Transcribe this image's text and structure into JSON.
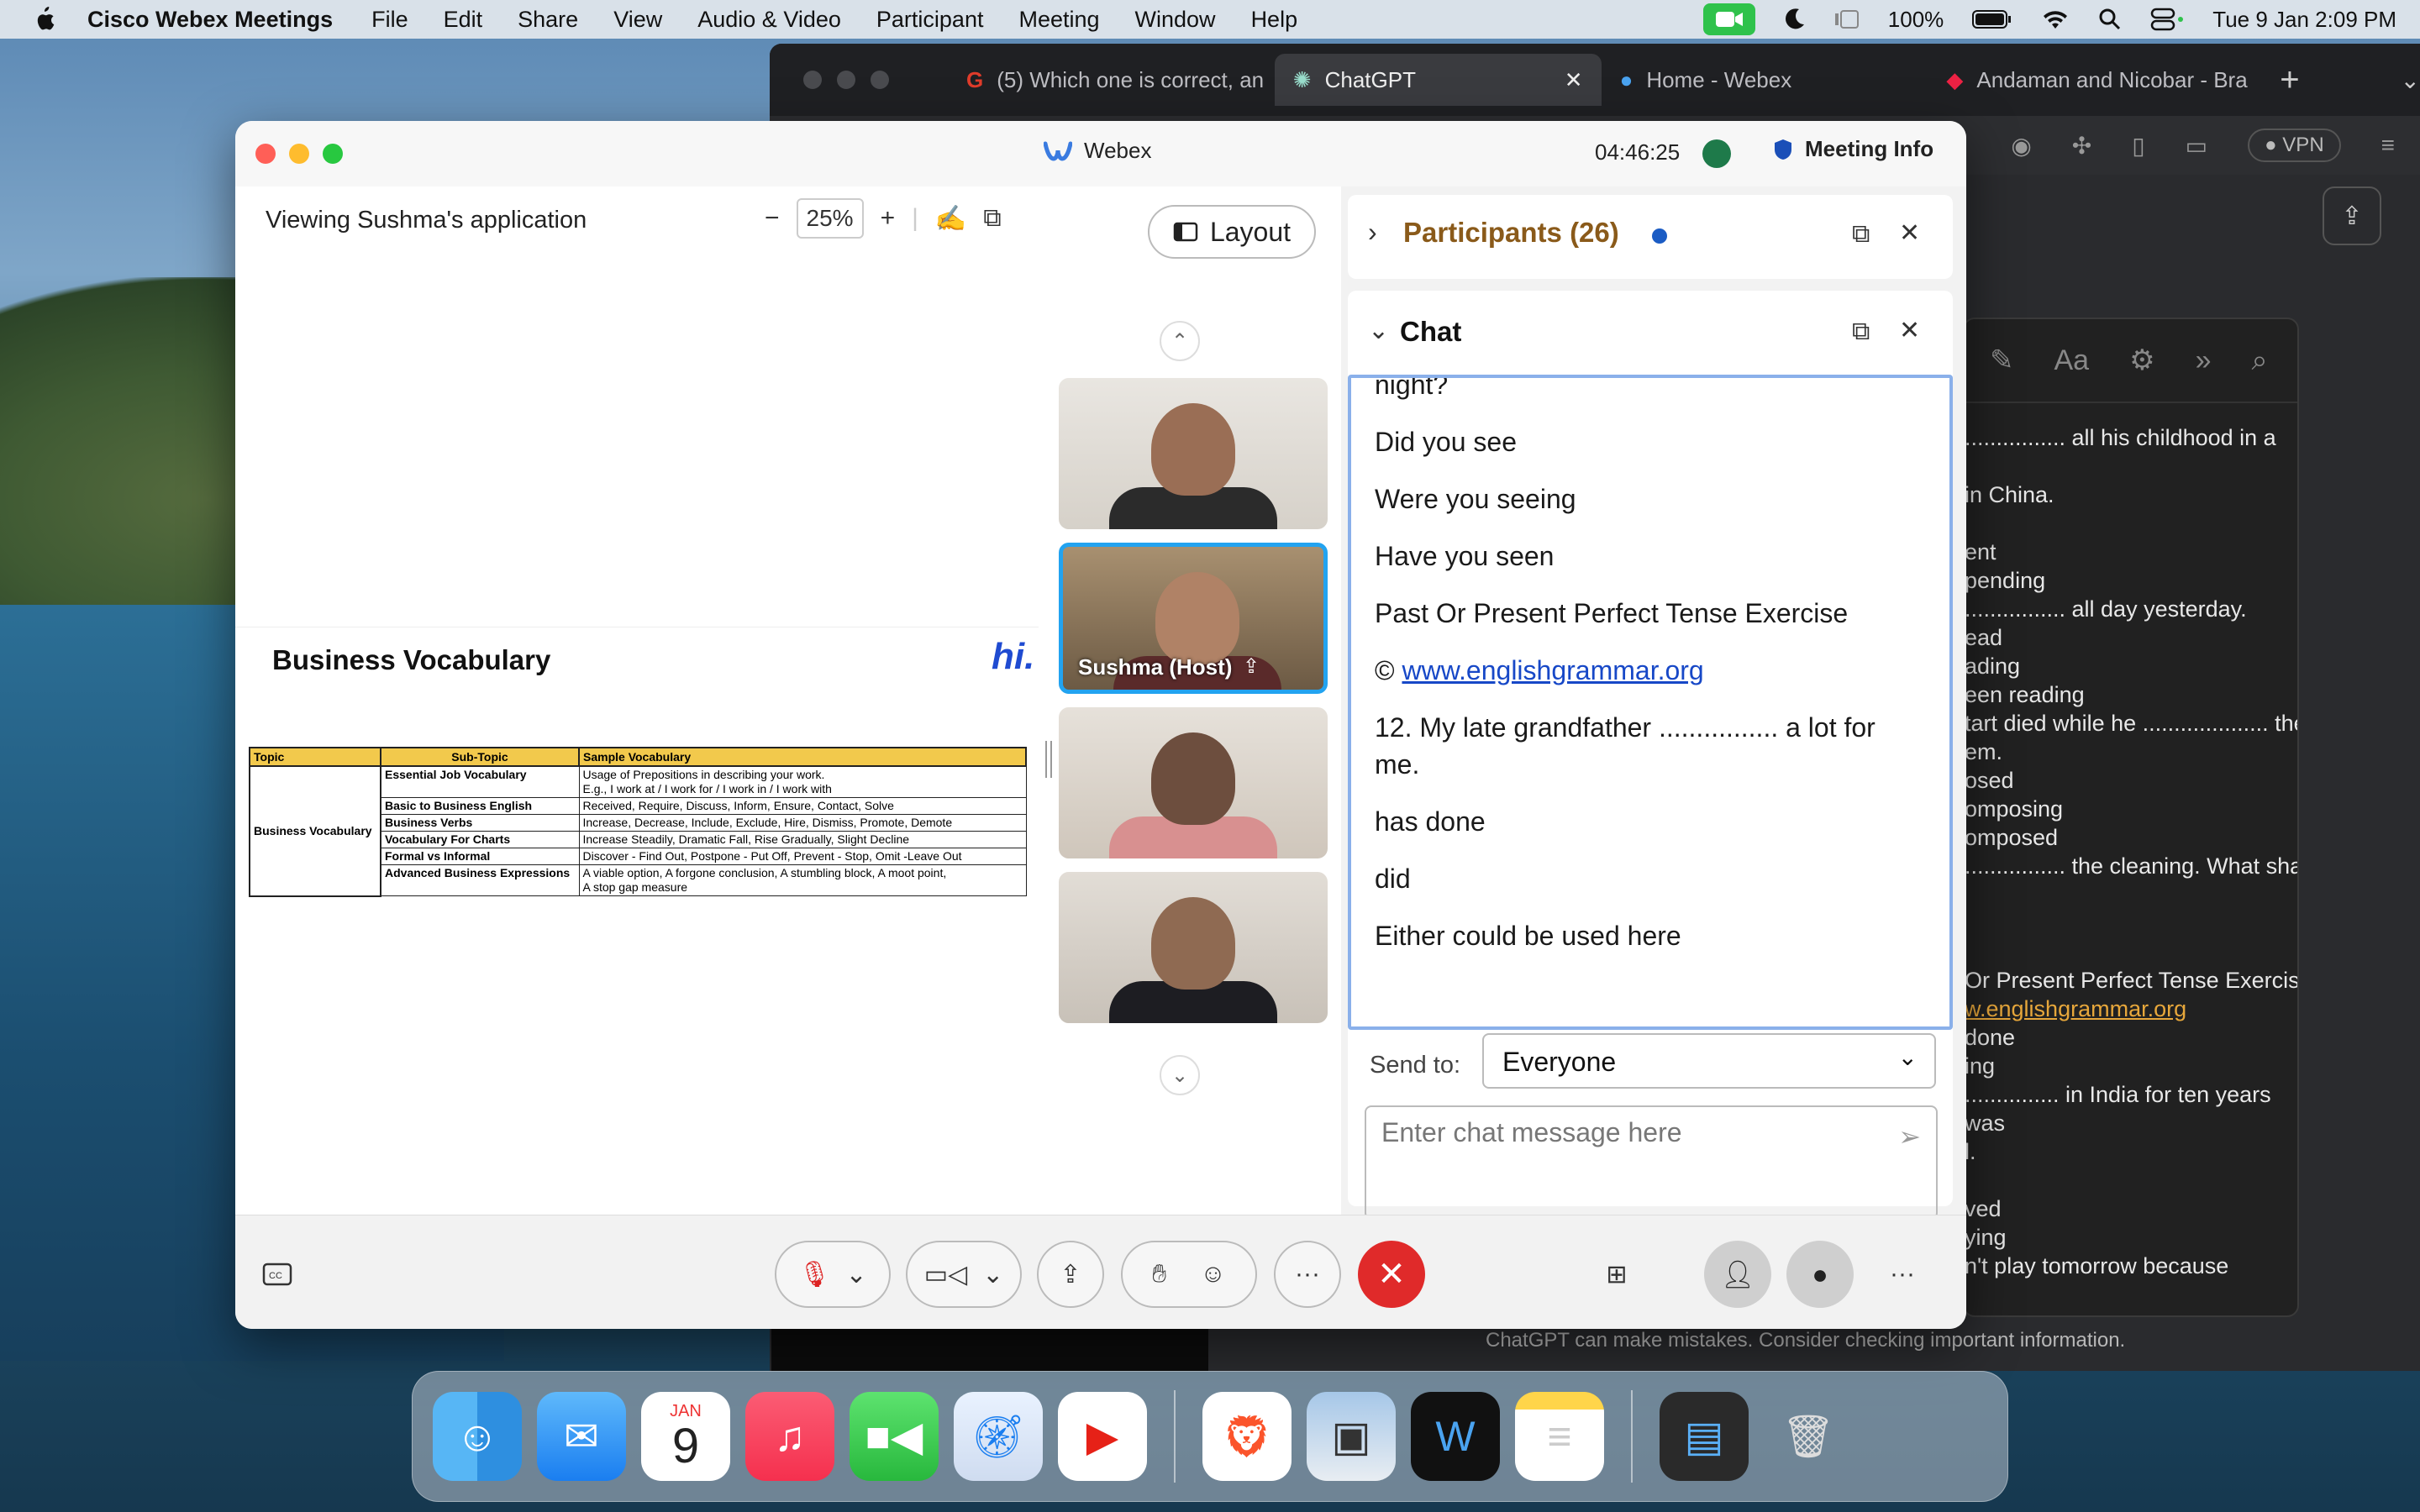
{
  "menubar": {
    "app_name": "Cisco Webex Meetings",
    "items": [
      "File",
      "Edit",
      "Share",
      "View",
      "Audio & Video",
      "Participant",
      "Meeting",
      "Window",
      "Help"
    ],
    "battery": "100%",
    "datetime": "Tue 9 Jan  2:09 PM"
  },
  "browser": {
    "tabs": [
      {
        "label": "(5) Which one is correct, an"
      },
      {
        "label": "ChatGPT"
      },
      {
        "label": "Home - Webex"
      },
      {
        "label": "Andaman and Nicobar - Bra"
      }
    ],
    "vpn_label": "VPN",
    "gpt_lines": [
      "................ all his childhood in a",
      "",
      "in China.",
      "",
      "ent",
      "pending",
      "................ all day yesterday.",
      "ead",
      "ading",
      "een reading",
      "tart died while he .................... the",
      "em.",
      "osed",
      "omposing",
      "omposed",
      "................ the cleaning. What shall",
      "",
      "",
      "",
      "Or Present Perfect Tense Exercise",
      "w.englishgrammar.org",
      "done",
      "ing",
      "............... in India for ten years",
      " was",
      "l.",
      "",
      "ved",
      "ying",
      "n't play tomorrow because"
    ],
    "footer": "ChatGPT can make mistakes. Consider checking important information."
  },
  "webex": {
    "title": "Webex",
    "timer": "04:46:25",
    "meeting_info": "Meeting Info",
    "viewing": "Viewing Sushma's application",
    "zoom": "25%",
    "layout_label": "Layout",
    "slide": {
      "title": "Business Vocabulary",
      "logo": "hi.",
      "headers": [
        "Topic",
        "Sub-Topic",
        "Sample Vocabulary"
      ],
      "topic": "Business Vocabulary",
      "rows": [
        {
          "sub": "Essential Job Vocabulary",
          "vocab": "Usage of Prepositions in describing your work.",
          "vocab2": "E.g., I work at / I work for / I work in / I work with"
        },
        {
          "sub": "Basic to Business English",
          "vocab": "Received, Require, Discuss, Inform, Ensure, Contact, Solve",
          "vocab2": ""
        },
        {
          "sub": "Business Verbs",
          "vocab": "Increase, Decrease, Include, Exclude, Hire, Dismiss, Promote, Demote",
          "vocab2": ""
        },
        {
          "sub": "Vocabulary For Charts",
          "vocab": "Increase Steadily, Dramatic Fall, Rise Gradually, Slight Decline",
          "vocab2": ""
        },
        {
          "sub": "Formal vs Informal",
          "vocab": "Discover - Find Out, Postpone - Put Off, Prevent - Stop, Omit -Leave Out",
          "vocab2": ""
        },
        {
          "sub": "Advanced Business Expressions",
          "vocab": "A viable option, A forgone conclusion, A stumbling block, A moot point,",
          "vocab2": "A stop gap measure"
        }
      ]
    },
    "host_label": "Sushma  (Host)",
    "participants_label": "Participants (26)",
    "chat": {
      "title": "Chat",
      "messages": [
        "night?",
        "Did you see",
        "Were you seeing",
        "Have you seen",
        "Past Or Present Perfect Tense Exercise",
        "©",
        "12. My late grandfather ................ a lot for me.",
        "has done",
        "did",
        "Either could be used here"
      ],
      "link": "www.englishgrammar.org",
      "send_to_label": "Send to:",
      "send_to_value": "Everyone",
      "input_placeholder": "Enter chat message here"
    }
  },
  "dock": {
    "calendar_month": "JAN",
    "calendar_day": "9",
    "apps": [
      "finder-icon",
      "mail-icon",
      "calendar-icon",
      "music-icon",
      "facetime-icon",
      "safari-icon",
      "youtube-icon",
      "brave-icon",
      "preview-icon",
      "webex-icon",
      "notes-icon",
      "downloads-icon",
      "trash-icon"
    ]
  }
}
